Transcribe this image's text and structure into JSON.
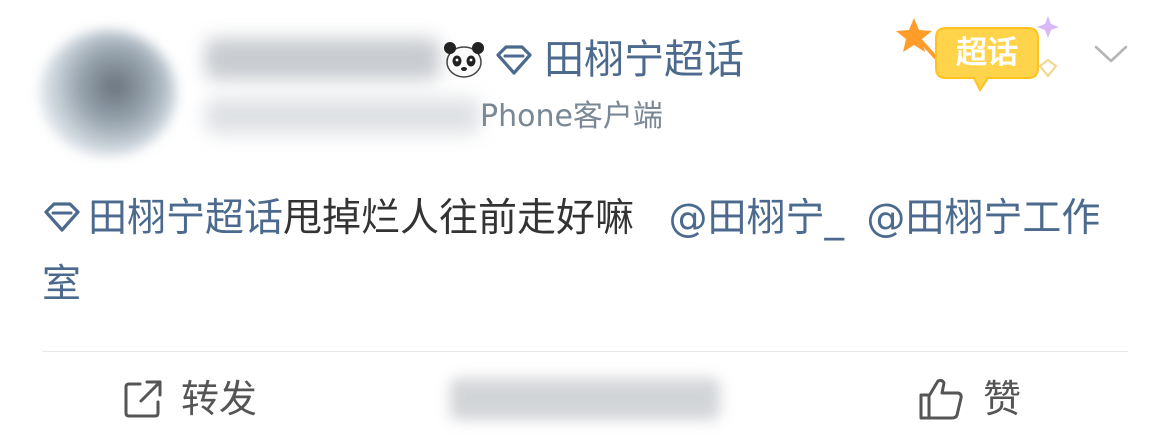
{
  "header": {
    "topic_name": "田栩宁超话",
    "source_text": "Phone客户端"
  },
  "badge": {
    "label": "超话"
  },
  "post": {
    "topic_link": "田栩宁超话",
    "body_text": "甩掉烂人往前走好嘛",
    "mention_1": "@田栩宁_",
    "mention_2": "@田栩宁工作室"
  },
  "actions": {
    "repost_label": "转发",
    "like_label": "赞"
  },
  "colors": {
    "link": "#4b6a8d",
    "text": "#333333",
    "badge_yellow": "#ffd44a"
  }
}
